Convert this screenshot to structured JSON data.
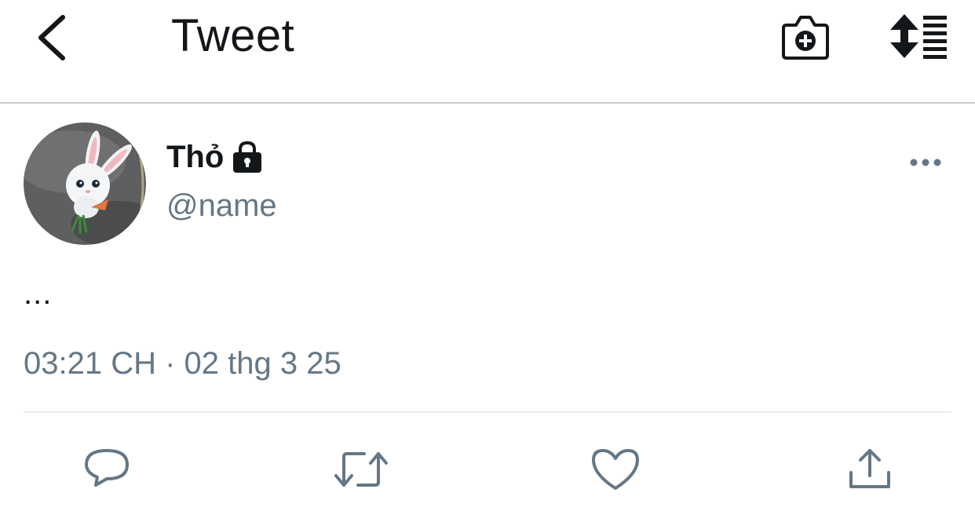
{
  "header": {
    "title": "Tweet",
    "icons": [
      "back-chevron-icon",
      "camera-plus-icon",
      "sort-lines-icon"
    ]
  },
  "tweet": {
    "author": {
      "display_name": "Thỏ",
      "username": "@name",
      "protected": true
    },
    "text": "...",
    "timestamp": "03:21 CH · 02 thg 3 25"
  },
  "actions": [
    "reply-icon",
    "retweet-icon",
    "like-icon",
    "share-icon"
  ],
  "colors": {
    "text_primary": "#14171a",
    "text_secondary": "#657786",
    "divider": "#e6ecf0"
  }
}
